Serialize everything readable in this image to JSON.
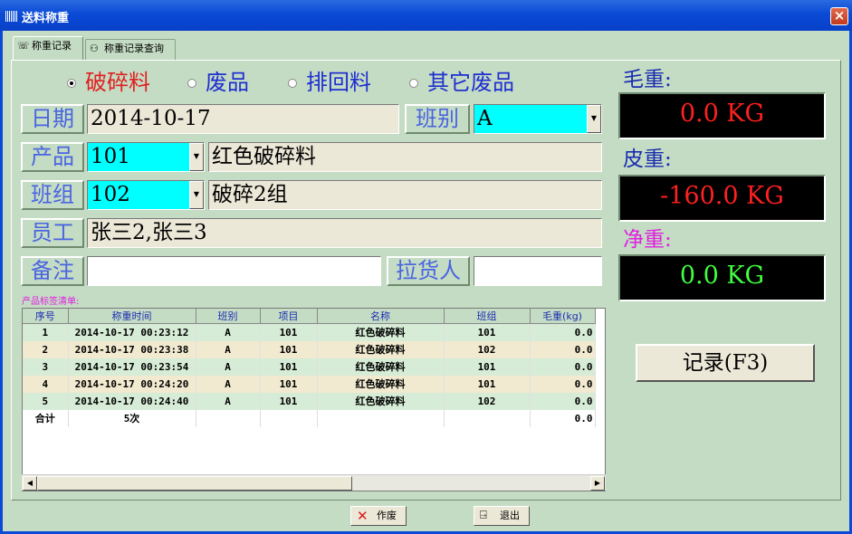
{
  "window": {
    "title": "送料称重",
    "close": "×"
  },
  "tabs": [
    {
      "label": "称重记录",
      "icon": "scale-icon"
    },
    {
      "label": "称重记录查询",
      "icon": "search-people-icon"
    }
  ],
  "material_types": {
    "options": [
      "破碎料",
      "废品",
      "排回料",
      "其它废品"
    ],
    "selected": "破碎料",
    "selected_color": "#e02020"
  },
  "form": {
    "date": {
      "label": "日期",
      "value": "2014-10-17"
    },
    "shift": {
      "label": "班别",
      "value": "A"
    },
    "product": {
      "label": "产品",
      "code": "101",
      "name": "红色破碎料"
    },
    "group": {
      "label": "班组",
      "code": "102",
      "name": "破碎2组"
    },
    "staff": {
      "label": "员工",
      "value": "张三2,张三3"
    },
    "note": {
      "label": "备注",
      "value": ""
    },
    "carrier": {
      "label": "拉货人",
      "value": ""
    }
  },
  "readouts": {
    "gross": {
      "label": "毛重:",
      "value": "0.0 KG",
      "label_color": "#1a2cb0",
      "value_color": "#ff2020"
    },
    "tare": {
      "label": "皮重:",
      "value": "-160.0 KG",
      "label_color": "#1a2cb0",
      "value_color": "#ff2020"
    },
    "net": {
      "label": "净重:",
      "value": "0.0 KG",
      "label_color": "#e020e0",
      "value_color": "#40ff40"
    }
  },
  "record_button": "记录(F3)",
  "list": {
    "title": "产品标签清单:",
    "columns": [
      "序号",
      "称重时间",
      "班别",
      "项目",
      "名称",
      "班组",
      "毛重(kg)"
    ],
    "rows": [
      [
        "1",
        "2014-10-17 00:23:12",
        "A",
        "101",
        "红色破碎料",
        "101",
        "0.0"
      ],
      [
        "2",
        "2014-10-17 00:23:38",
        "A",
        "101",
        "红色破碎料",
        "102",
        "0.0"
      ],
      [
        "3",
        "2014-10-17 00:23:54",
        "A",
        "101",
        "红色破碎料",
        "101",
        "0.0"
      ],
      [
        "4",
        "2014-10-17 00:24:20",
        "A",
        "101",
        "红色破碎料",
        "101",
        "0.0"
      ],
      [
        "5",
        "2014-10-17 00:24:40",
        "A",
        "101",
        "红色破碎料",
        "102",
        "0.0"
      ]
    ],
    "total": {
      "label": "合计",
      "count": "5次",
      "weight": "0.0"
    }
  },
  "bottom_buttons": {
    "void": {
      "label": "作废",
      "icon": "x-icon"
    },
    "exit": {
      "label": "退出",
      "icon": "exit-door-icon"
    }
  }
}
